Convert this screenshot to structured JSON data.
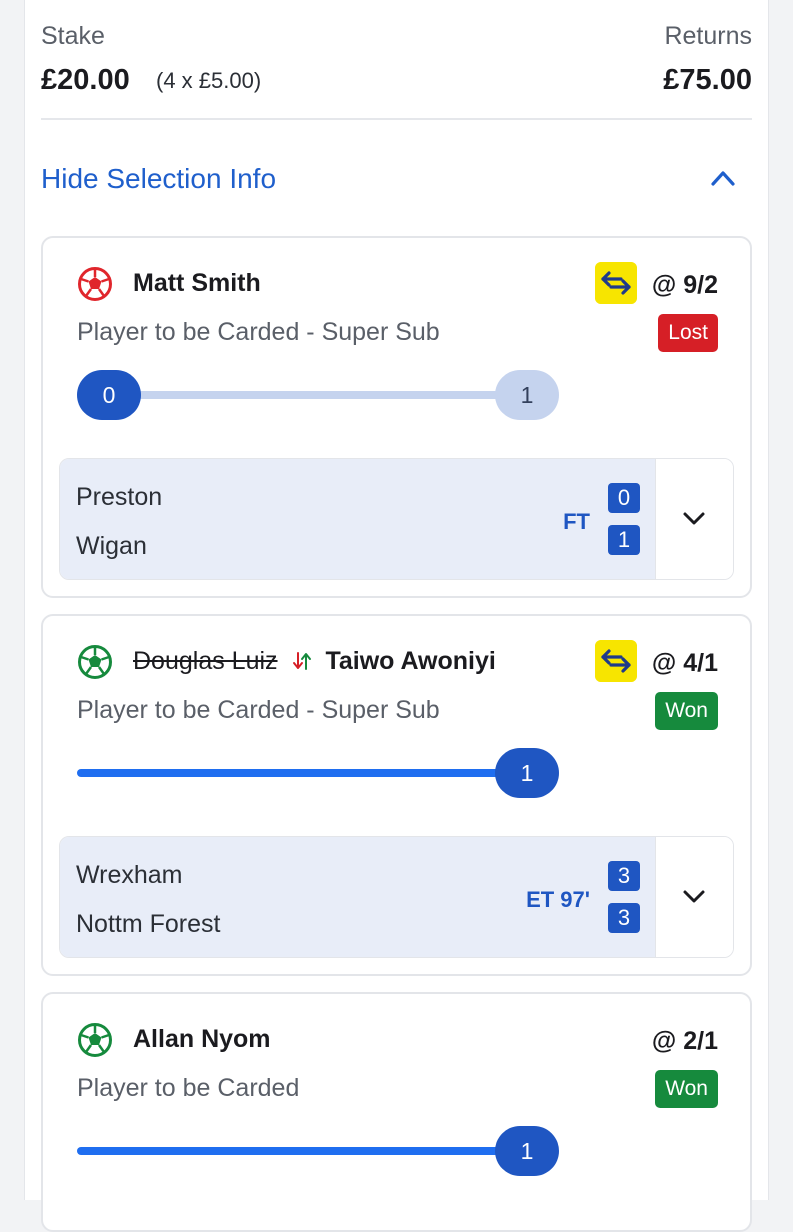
{
  "summary": {
    "stake_label": "Stake",
    "stake_value": "£20.00",
    "stake_breakdown": "(4 x £5.00)",
    "returns_label": "Returns",
    "returns_value": "£75.00"
  },
  "toggle": {
    "label": "Hide Selection Info",
    "icon": "chevron-up-icon"
  },
  "selections": [
    {
      "player": "Matt Smith",
      "ball_color": "#e0262c",
      "odds": "@ 9/2",
      "market": "Player to be Carded - Super Sub",
      "result": "Lost",
      "progress_start": "0",
      "progress_end": "1",
      "event": {
        "home": "Preston",
        "away": "Wigan",
        "status": "FT",
        "home_score": "0",
        "away_score": "1"
      }
    },
    {
      "player_replaced": "Douglas Luiz",
      "player": "Taiwo Awoniyi",
      "ball_color": "#168a3d",
      "odds": "@ 4/1",
      "market": "Player to be Carded - Super Sub",
      "result": "Won",
      "progress_end": "1",
      "event": {
        "home": "Wrexham",
        "away": "Nottm Forest",
        "status": "ET 97'",
        "home_score": "3",
        "away_score": "3"
      }
    },
    {
      "player": "Allan Nyom",
      "ball_color": "#168a3d",
      "odds": "@ 2/1",
      "market": "Player to be Carded",
      "result": "Won",
      "progress_end": "1"
    }
  ],
  "colors": {
    "brand_blue": "#1f56c2",
    "link_blue": "#1f5fcc",
    "boost_yellow": "#f7e500",
    "lost_red": "#d61f26",
    "won_green": "#168a3d"
  }
}
